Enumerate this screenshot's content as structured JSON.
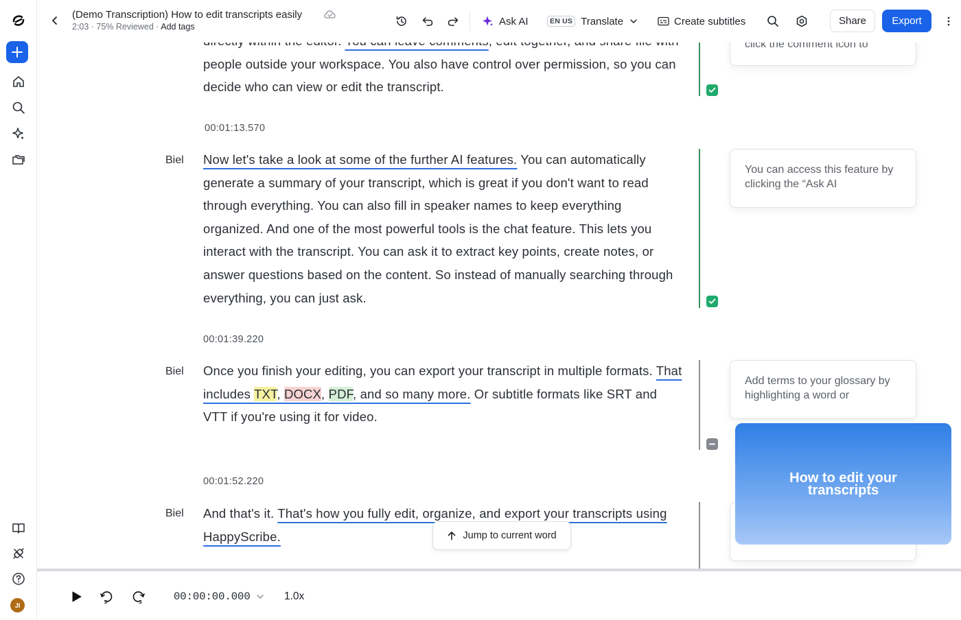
{
  "header": {
    "title": "(Demo Transcription) How to edit transcripts easily",
    "meta": "2:03 · 75% Reviewed · ",
    "add_tags": "Add tags",
    "ask_ai": "Ask AI",
    "lang_badge": "EN US",
    "translate": "Translate",
    "create_subtitles": "Create subtitles",
    "share": "Share",
    "export": "Export"
  },
  "transcript": {
    "block0": {
      "line0a": "directly within the editor. ",
      "line0b": "You can leave comments",
      "line0c": ", edit together, and share",
      "rest": "file with people outside your workspace. You also have control over permission, so you can decide who can view or edit the transcript."
    },
    "block1": {
      "timestamp": "00:01:13.570",
      "speaker": "Biel",
      "underlined": "Now let's take a look at some of the further AI features.",
      "rest": " You can automatically generate a summary of your transcript, which is great if you don't want to read through everything. You can also fill in speaker names to keep everything organized. And one of the most powerful tools is the chat feature. This lets you interact with the transcript. You can ask it to extract key points, create notes, or answer questions based on the content. So instead of manually searching through everything, you can just ask."
    },
    "block2": {
      "timestamp": "00:01:39.220",
      "speaker": "Biel",
      "pre": "Once you finish your editing, you can export your transcript in multiple formats. ",
      "u1": "That includes ",
      "txt": "TXT",
      "c1": ", ",
      "docx": "DOCX",
      "c2": ", ",
      "pdf": "PDF",
      "u2": ", and so many more.",
      "post": " Or subtitle formats like SRT and VTT if you're using it for video."
    },
    "block3": {
      "timestamp": "00:01:52.220",
      "speaker": "Biel",
      "pre": "And that's it. ",
      "underlined": "That's how you fully edit, organize, and export your transcripts using HappyScribe."
    }
  },
  "comments": {
    "c0": "click the comment icon to",
    "c1": "You can access this feature by clicking the “Ask AI",
    "c2": "Add terms to your glossary by highlighting a word or"
  },
  "jump_label": "Jump to current word",
  "video_title": "How to edit your transcripts",
  "player": {
    "time": "00:00:00.000",
    "speed": "1.0x",
    "progress": 0
  },
  "avatar_initials": "JI",
  "colors": {
    "accent": "#1a63e8",
    "reviewed": "#1faa6b",
    "unreviewed": "#85898f"
  }
}
